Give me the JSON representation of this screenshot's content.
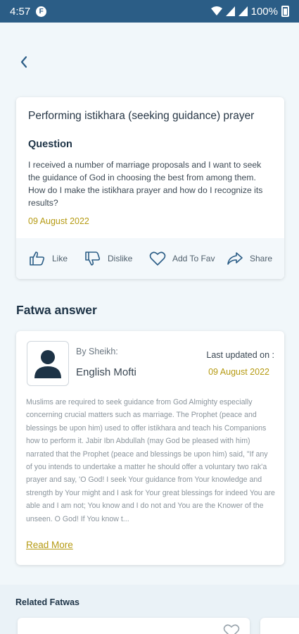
{
  "status_bar": {
    "time": "4:57",
    "battery": "100%"
  },
  "question_card": {
    "title": "Performing istikhara (seeking guidance) prayer",
    "heading": "Question",
    "body": "I received a number of marriage proposals and I want to seek the guidance of God in choosing the best from among them. How do I make the istikhara prayer and how do I recognize its results?",
    "date": "09 August 2022"
  },
  "actions": {
    "like": "Like",
    "dislike": "Dislike",
    "fav": "Add To Fav",
    "share": "Share"
  },
  "answer_section": {
    "title": "Fatwa answer"
  },
  "answer_card": {
    "by_label": "By Sheikh:",
    "sheikh_name": "English Mofti",
    "updated_label": "Last updated on :",
    "updated_date": "09 August 2022",
    "body": "Muslims are required to seek guidance from God Almighty especially concerning crucial matters such as marriage. The Prophet (peace and blessings be upon him) used to offer istikhara and teach his Companions how to perform it. Jabir Ibn Abdullah (may God be pleased with him) narrated that the Prophet (peace and blessings be upon him) said, \"If any of you intends to undertake a matter he should offer a voluntary two rak'a prayer and say, 'O God! I seek Your guidance from Your knowledge and strength by Your might and I ask for Your great blessings for indeed You are able and I am not; You know and I do not and You are the Knower of the unseen. O God! If You know t...",
    "read_more": "Read More"
  },
  "related": {
    "title": "Related Fatwas"
  },
  "colors": {
    "primary": "#2b5d86",
    "accent_gold": "#b59a12",
    "background": "#f1f7fa"
  }
}
